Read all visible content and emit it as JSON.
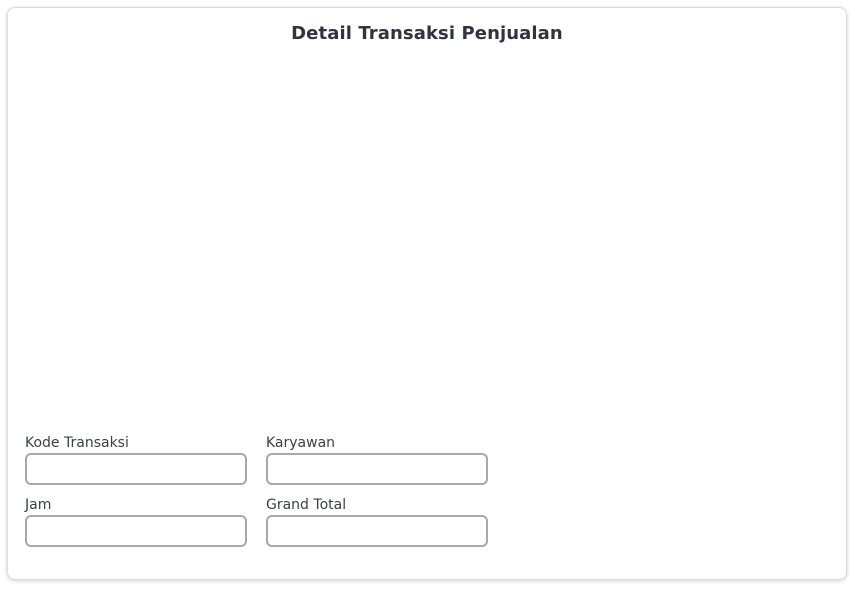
{
  "page": {
    "title": "Detail Transaksi Penjualan"
  },
  "form": {
    "kode_transaksi": {
      "label": "Kode Transaksi",
      "value": ""
    },
    "karyawan": {
      "label": "Karyawan",
      "value": ""
    },
    "jam": {
      "label": "Jam",
      "value": ""
    },
    "grand_total": {
      "label": "Grand Total",
      "value": ""
    }
  },
  "colors": {
    "text": "#2f3440",
    "input_border": "#a8a8a8",
    "card_border": "#dcdcdc"
  }
}
